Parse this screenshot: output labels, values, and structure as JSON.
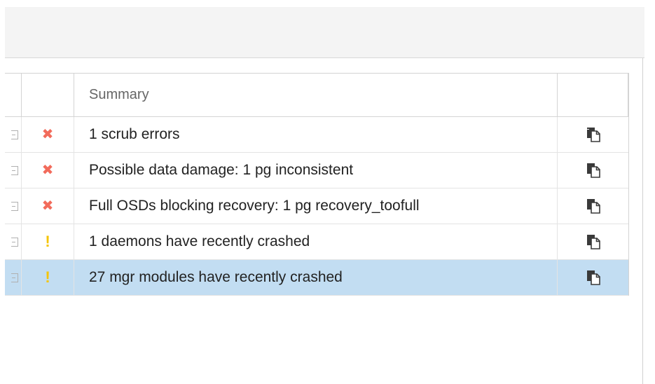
{
  "table": {
    "columns": [
      "",
      "",
      "Summary",
      ""
    ],
    "rows": [
      {
        "status": "error",
        "summary": "1 scrub errors",
        "status_icon": "error-x-icon"
      },
      {
        "status": "error",
        "summary": "Possible data damage: 1 pg inconsistent",
        "status_icon": "error-x-icon"
      },
      {
        "status": "error",
        "summary": "Full OSDs blocking recovery: 1 pg recovery_toofull",
        "status_icon": "error-x-icon"
      },
      {
        "status": "warning",
        "summary": "1 daemons have recently crashed",
        "status_icon": "warning-exclamation-icon"
      },
      {
        "status": "warning",
        "summary": "27 mgr modules have recently crashed",
        "status_icon": "warning-exclamation-icon",
        "selected": true
      }
    ]
  },
  "glyphs": {
    "error": "✖",
    "warning": "!"
  },
  "colors": {
    "error": "#f26b5b",
    "warning": "#f5c400",
    "selected_row": "#c2ddf2"
  }
}
